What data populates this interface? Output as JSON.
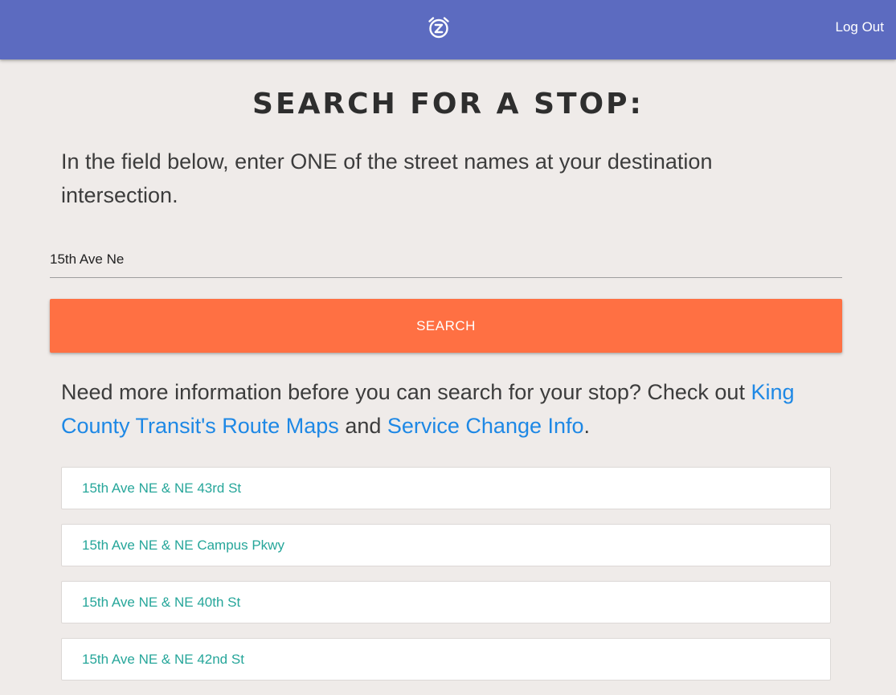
{
  "header": {
    "logo_icon": "alarm-clock-z-icon",
    "logout_label": "Log Out",
    "bg_color": "#5c6bc0"
  },
  "main": {
    "title": "Search for a stop:",
    "instructions": "In the field below, enter ONE of the street names at your destination intersection.",
    "search_value": "15th Ave Ne",
    "search_button_label": "SEARCH",
    "search_button_color": "#ff7043",
    "help": {
      "prefix": "Need more information before you can search for your stop? Check out ",
      "link1": "King County Transit's Route Maps",
      "middle": " and ",
      "link2": "Service Change Info",
      "suffix": "."
    },
    "results": [
      "15th Ave NE & NE 43rd St",
      "15th Ave NE & NE Campus Pkwy",
      "15th Ave NE & NE 40th St",
      "15th Ave NE & NE 42nd St"
    ],
    "result_text_color": "#26a69a",
    "link_color": "#1e88e5"
  }
}
